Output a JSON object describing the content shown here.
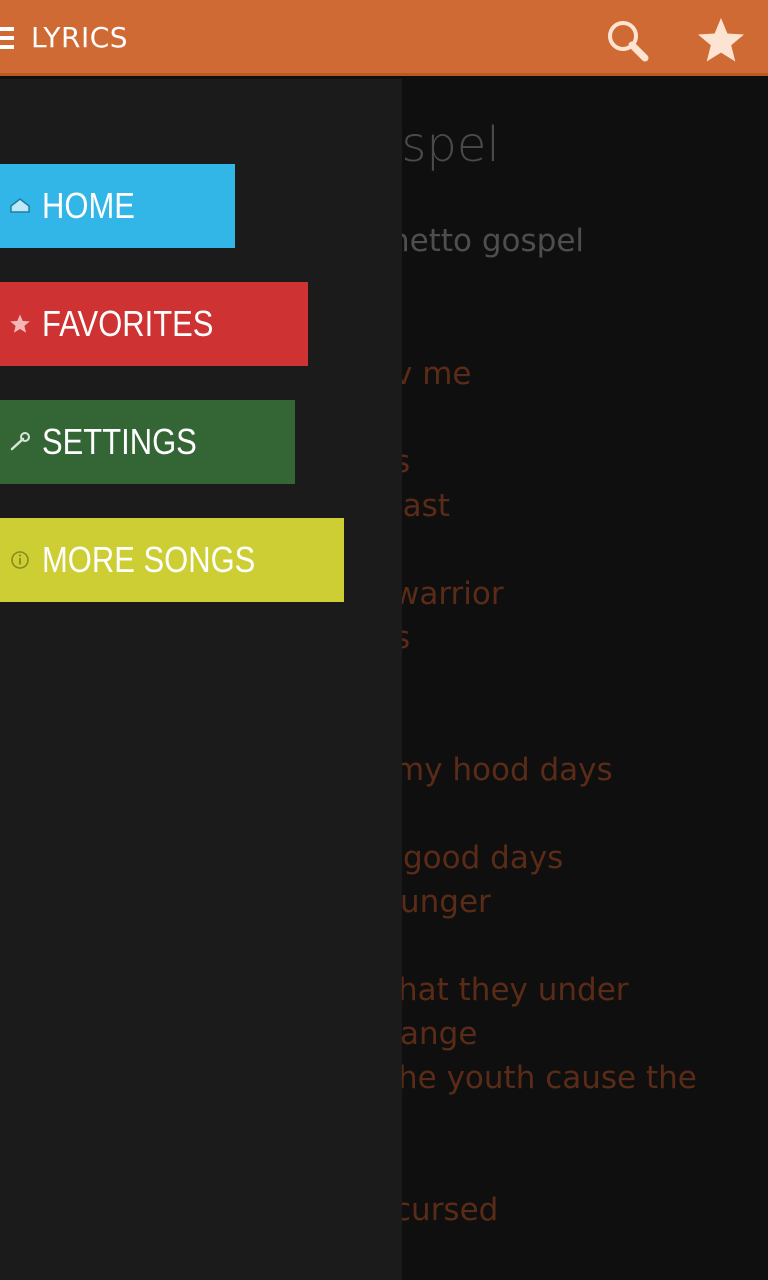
{
  "appbar": {
    "title": "LYRICS",
    "icons": [
      "menu-icon",
      "search-icon",
      "star-icon"
    ],
    "color": "#d06a34"
  },
  "song": {
    "title_visible": "ospel",
    "artist_visible": "hetto gospel",
    "lines_visible": [
      "v me",
      "s",
      "last",
      "warrior",
      "s",
      " my hood days",
      "good days",
      "unger",
      "hat they under",
      "ange",
      "he youth cause the",
      " cursed"
    ],
    "lyric_color": "#5a2b16"
  },
  "drawer": {
    "items": [
      {
        "label": "HOME",
        "icon": "home-icon",
        "color": "#31b6e7"
      },
      {
        "label": "FAVORITES",
        "icon": "star-icon",
        "color": "#cf3232"
      },
      {
        "label": "SETTINGS",
        "icon": "wrench-icon",
        "color": "#336634"
      },
      {
        "label": "MORE SONGS",
        "icon": "info-icon",
        "color": "#ccce33"
      }
    ]
  }
}
